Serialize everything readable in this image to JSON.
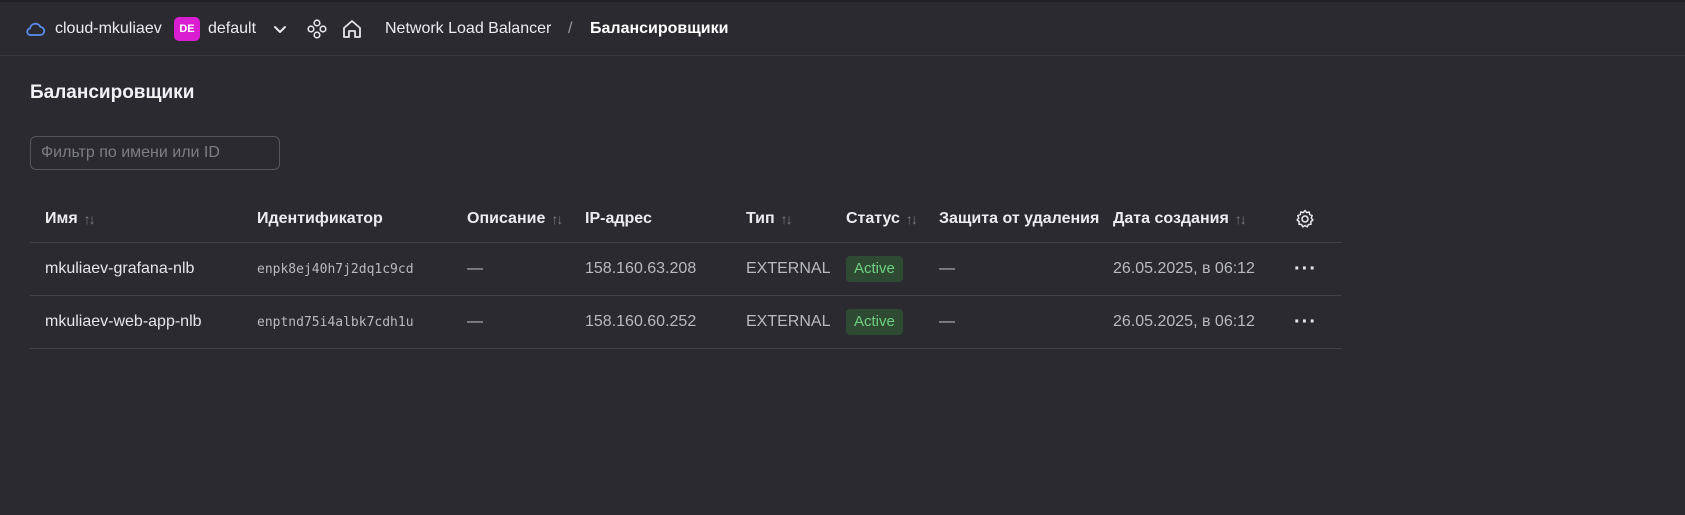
{
  "topbar": {
    "cloud_name": "cloud-mkuliaev",
    "folder_badge": "DE",
    "folder_name": "default",
    "breadcrumb_service": "Network Load Balancer",
    "breadcrumb_separator": "/",
    "breadcrumb_current": "Балансировщики"
  },
  "page": {
    "title": "Балансировщики",
    "filter_placeholder": "Фильтр по имени или ID"
  },
  "table": {
    "columns": {
      "name": "Имя",
      "id": "Идентификатор",
      "description": "Описание",
      "ip": "IP-адрес",
      "type": "Тип",
      "status": "Статус",
      "protection": "Защита от удаления",
      "created": "Дата создания"
    },
    "sort_glyph": "↑↓",
    "rows": [
      {
        "name": "mkuliaev-grafana-nlb",
        "id": "enpk8ej40h7j2dq1c9cd",
        "description": "—",
        "ip": "158.160.63.208",
        "type": "EXTERNAL",
        "status": "Active",
        "protection": "—",
        "created": "26.05.2025, в 06:12",
        "actions": "···"
      },
      {
        "name": "mkuliaev-web-app-nlb",
        "id": "enptnd75i4albk7cdh1u",
        "description": "—",
        "ip": "158.160.60.252",
        "type": "EXTERNAL",
        "status": "Active",
        "protection": "—",
        "created": "26.05.2025, в 06:12",
        "actions": "···"
      }
    ]
  },
  "colors": {
    "background": "#2a2a30",
    "folder_badge": "#d91ed1",
    "status_active_bg": "#2f4a33",
    "status_active_text": "#6fd080",
    "cloud_icon": "#5b8def"
  },
  "icons": {
    "cloud": "cloud-icon",
    "chevron": "chevron-down-icon",
    "services": "services-icon",
    "home": "home-icon",
    "settings": "gear-icon",
    "actions": "more-icon"
  }
}
